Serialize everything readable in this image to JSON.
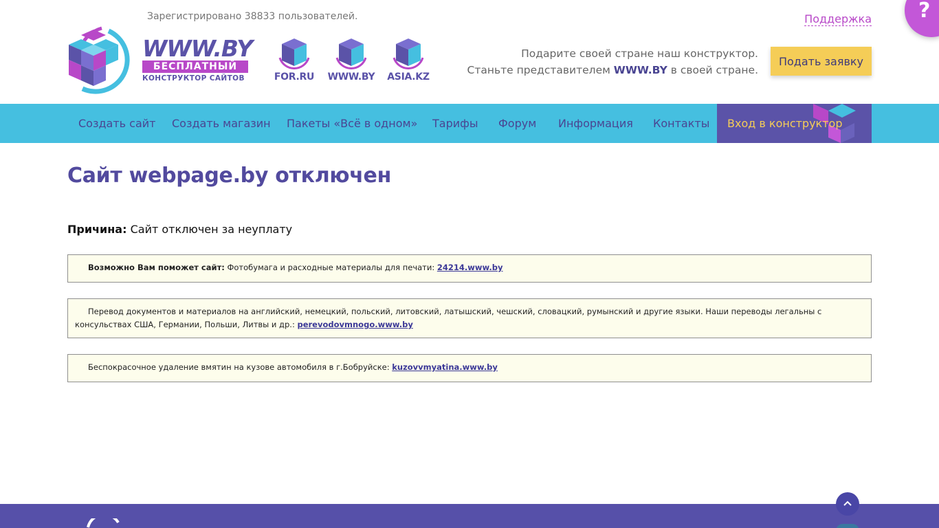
{
  "header": {
    "registered_text": "Зарегистрировано 38833 пользователей.",
    "logo": {
      "title": "WWW.BY",
      "tag": "БЕСПЛАТНЫЙ",
      "subtitle": "КОНСТРУКТОР САЙТОВ"
    },
    "partners": [
      {
        "label": "FOR.RU"
      },
      {
        "label": "WWW.BY"
      },
      {
        "label": "ASIA.KZ"
      }
    ],
    "support_label": "Поддержка",
    "promo_line1": "Подарите своей стране наш конструктор.",
    "promo_line2_pre": "Станьте представителем ",
    "promo_brand": "WWW.BY",
    "promo_line2_post": " в своей стране.",
    "apply_button": "Подать заявку",
    "help_symbol": "?"
  },
  "nav": {
    "items": [
      {
        "label": "Создать сайт"
      },
      {
        "label": "Создать магазин"
      },
      {
        "label": "Пакеты «Всё в одном»"
      },
      {
        "label": "Тарифы"
      },
      {
        "label": "Форум"
      },
      {
        "label": "Информация"
      },
      {
        "label": "Контакты"
      }
    ],
    "login_label": "Вход в конструктор"
  },
  "main": {
    "title": "Сайт webpage.by отключен",
    "reason_label": "Причина:",
    "reason_text": " Сайт отключен за неуплату",
    "ads": [
      {
        "lead": "Возможно Вам поможет сайт:",
        "text": " Фотобумага и расходные материалы для печати: ",
        "link": "24214.www.by"
      },
      {
        "text": "Перевод документов и материалов на английский, немецкий, польский, литовский, латышский, чешский, словацкий, румынский и другие языки. Наши переводы легальны с консульствах США, Германии, Польши, Литвы и др.: ",
        "link": "perevodovmnogo.www.by"
      },
      {
        "text": "Беспокрасочное удаление вмятин на кузове автомобиля в г.Бобруйске: ",
        "link": "kuzovvmyatina.www.by"
      }
    ]
  },
  "colors": {
    "brand_purple": "#524a9e",
    "nav_blue": "#45bfe0",
    "accent_yellow": "#f5cd57",
    "help_pink": "#c357d8",
    "footer": "#5650a9"
  },
  "icons": {
    "logo": "cube-logo-icon",
    "help": "question-icon",
    "scroll_top": "chevron-up-icon"
  }
}
